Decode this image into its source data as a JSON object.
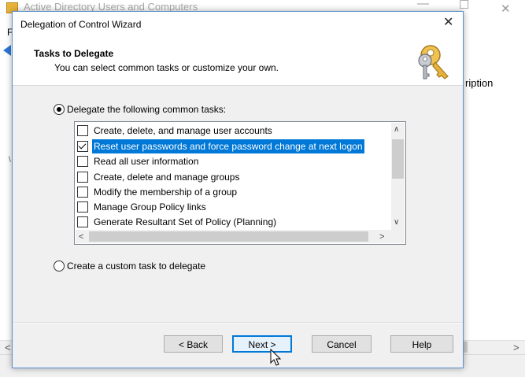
{
  "background_window": {
    "title": "Active Directory Users and Computers",
    "menu_first": "F",
    "column_header": "ription",
    "tree_mark": "\\",
    "min_glyph": "—",
    "max_glyph": "☐",
    "close_glyph": "✕",
    "scroll_left": "<",
    "scroll_right": ">"
  },
  "dialog": {
    "title": "Delegation of Control Wizard",
    "close_glyph": "✕",
    "header": {
      "title": "Tasks to Delegate",
      "subtitle": "You can select common tasks or customize your own.",
      "icon": "keys-icon"
    },
    "options": {
      "common": {
        "label": "Delegate the following common tasks:",
        "selected": true
      },
      "custom": {
        "label": "Create a custom task to delegate",
        "selected": false
      }
    },
    "tasks": [
      {
        "label": "Create, delete, and manage user accounts",
        "checked": false,
        "selected": false
      },
      {
        "label": "Reset user passwords and force password change at next logon",
        "checked": true,
        "selected": true
      },
      {
        "label": "Read all user information",
        "checked": false,
        "selected": false
      },
      {
        "label": "Create, delete and manage groups",
        "checked": false,
        "selected": false
      },
      {
        "label": "Modify the membership of a group",
        "checked": false,
        "selected": false
      },
      {
        "label": "Manage Group Policy links",
        "checked": false,
        "selected": false
      },
      {
        "label": "Generate Resultant Set of Policy (Planning)",
        "checked": false,
        "selected": false
      }
    ],
    "scroll_glyphs": {
      "up": "∧",
      "down": "∨",
      "left": "<",
      "right": ">"
    },
    "buttons": {
      "back": "< Back",
      "next": "Next >",
      "cancel": "Cancel",
      "help": "Help"
    }
  },
  "colors": {
    "selection": "#0078d7",
    "dialog_border": "#5b8fd0",
    "icon_gold": "#e8b53a"
  }
}
